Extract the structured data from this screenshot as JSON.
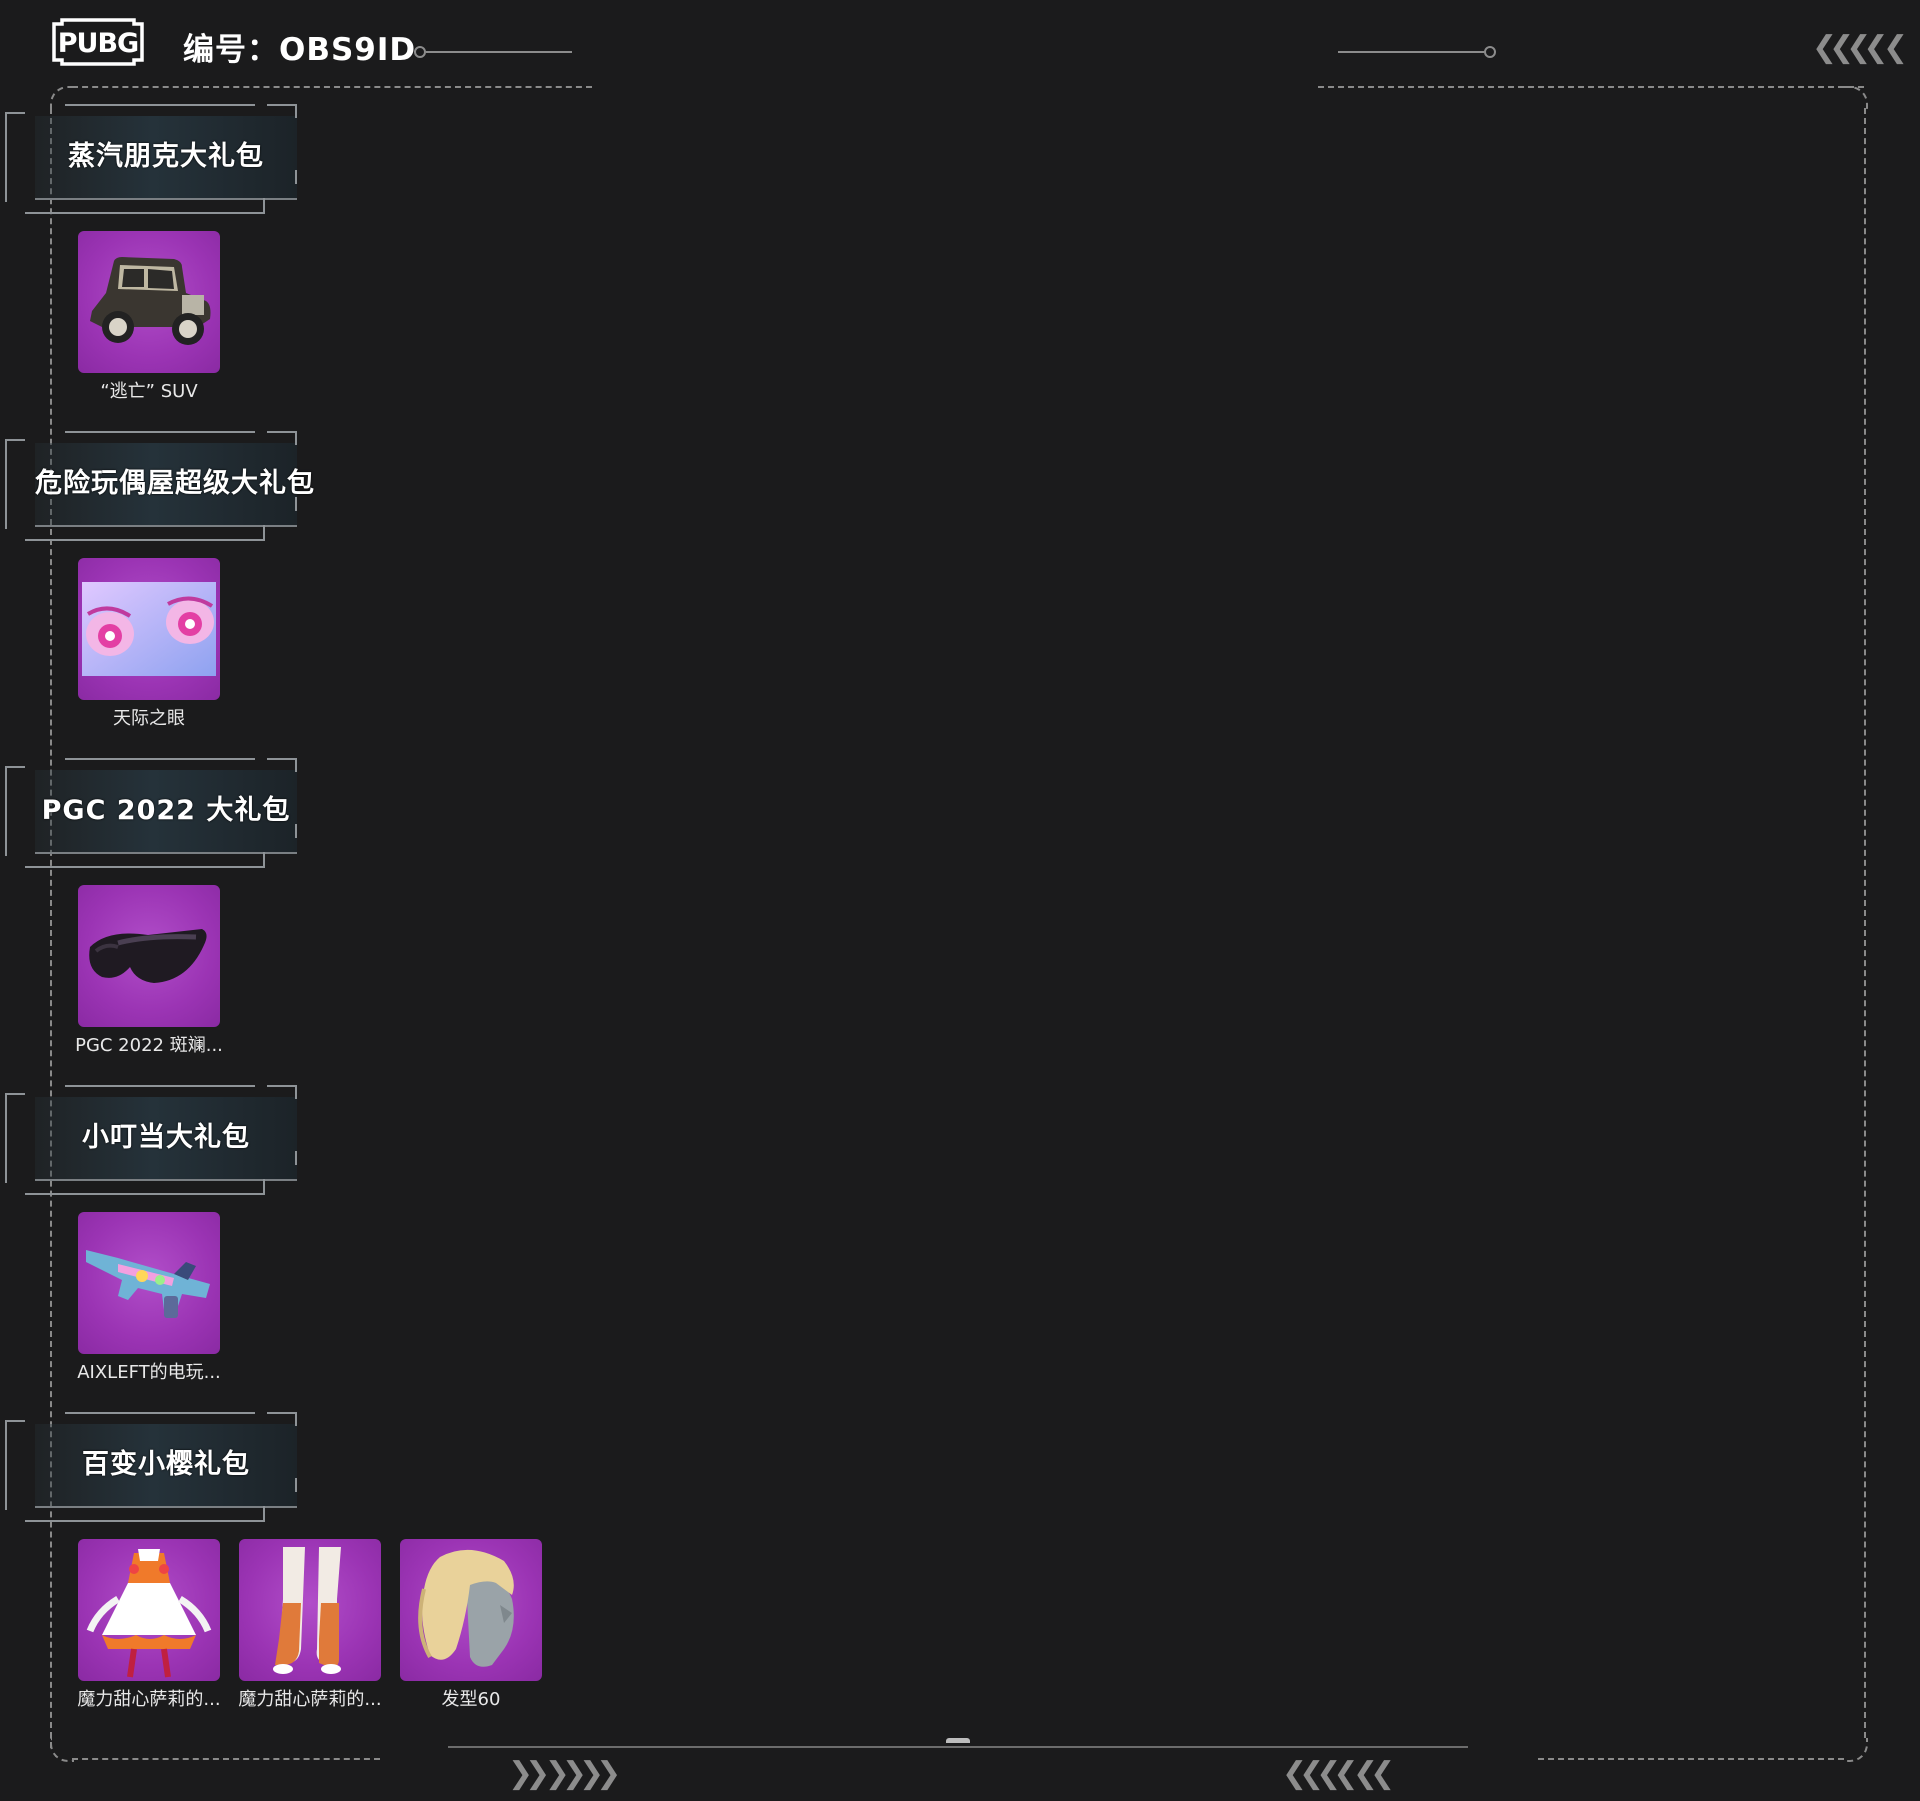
{
  "header": {
    "logo_text": "PUBG",
    "id_text": "编号：OBS9ID",
    "top_right_arrows": "❮❮❮❮ ❮"
  },
  "sections": [
    {
      "title": "蒸汽朋克大礼包",
      "items": [
        {
          "label": "“逃亡” SUV",
          "icon": "car-icon"
        }
      ]
    },
    {
      "title": "危险玩偶屋超级大礼包",
      "items": [
        {
          "label": "天际之眼",
          "icon": "eyes-icon"
        }
      ]
    },
    {
      "title": "PGC 2022 大礼包",
      "items": [
        {
          "label": "PGC 2022 斑斓...",
          "icon": "goggles-icon"
        }
      ]
    },
    {
      "title": "小叮当大礼包",
      "items": [
        {
          "label": "AIXLEFT的电玩...",
          "icon": "gun-icon"
        }
      ]
    },
    {
      "title": "百变小樱礼包",
      "items": [
        {
          "label": "魔力甜心萨莉的...",
          "icon": "dress-icon"
        },
        {
          "label": "魔力甜心萨莉的...",
          "icon": "boots-icon"
        },
        {
          "label": "发型60",
          "icon": "hair-icon"
        }
      ]
    }
  ],
  "footer": {
    "left_arrows": "❯❯ ❯❯❯❯",
    "right_arrows": "❮❮❮❮ ❮❮"
  },
  "colors": {
    "background": "#1b1b1c",
    "item_purple": "#a23dbd",
    "frame_gray": "#8a8a8a"
  }
}
